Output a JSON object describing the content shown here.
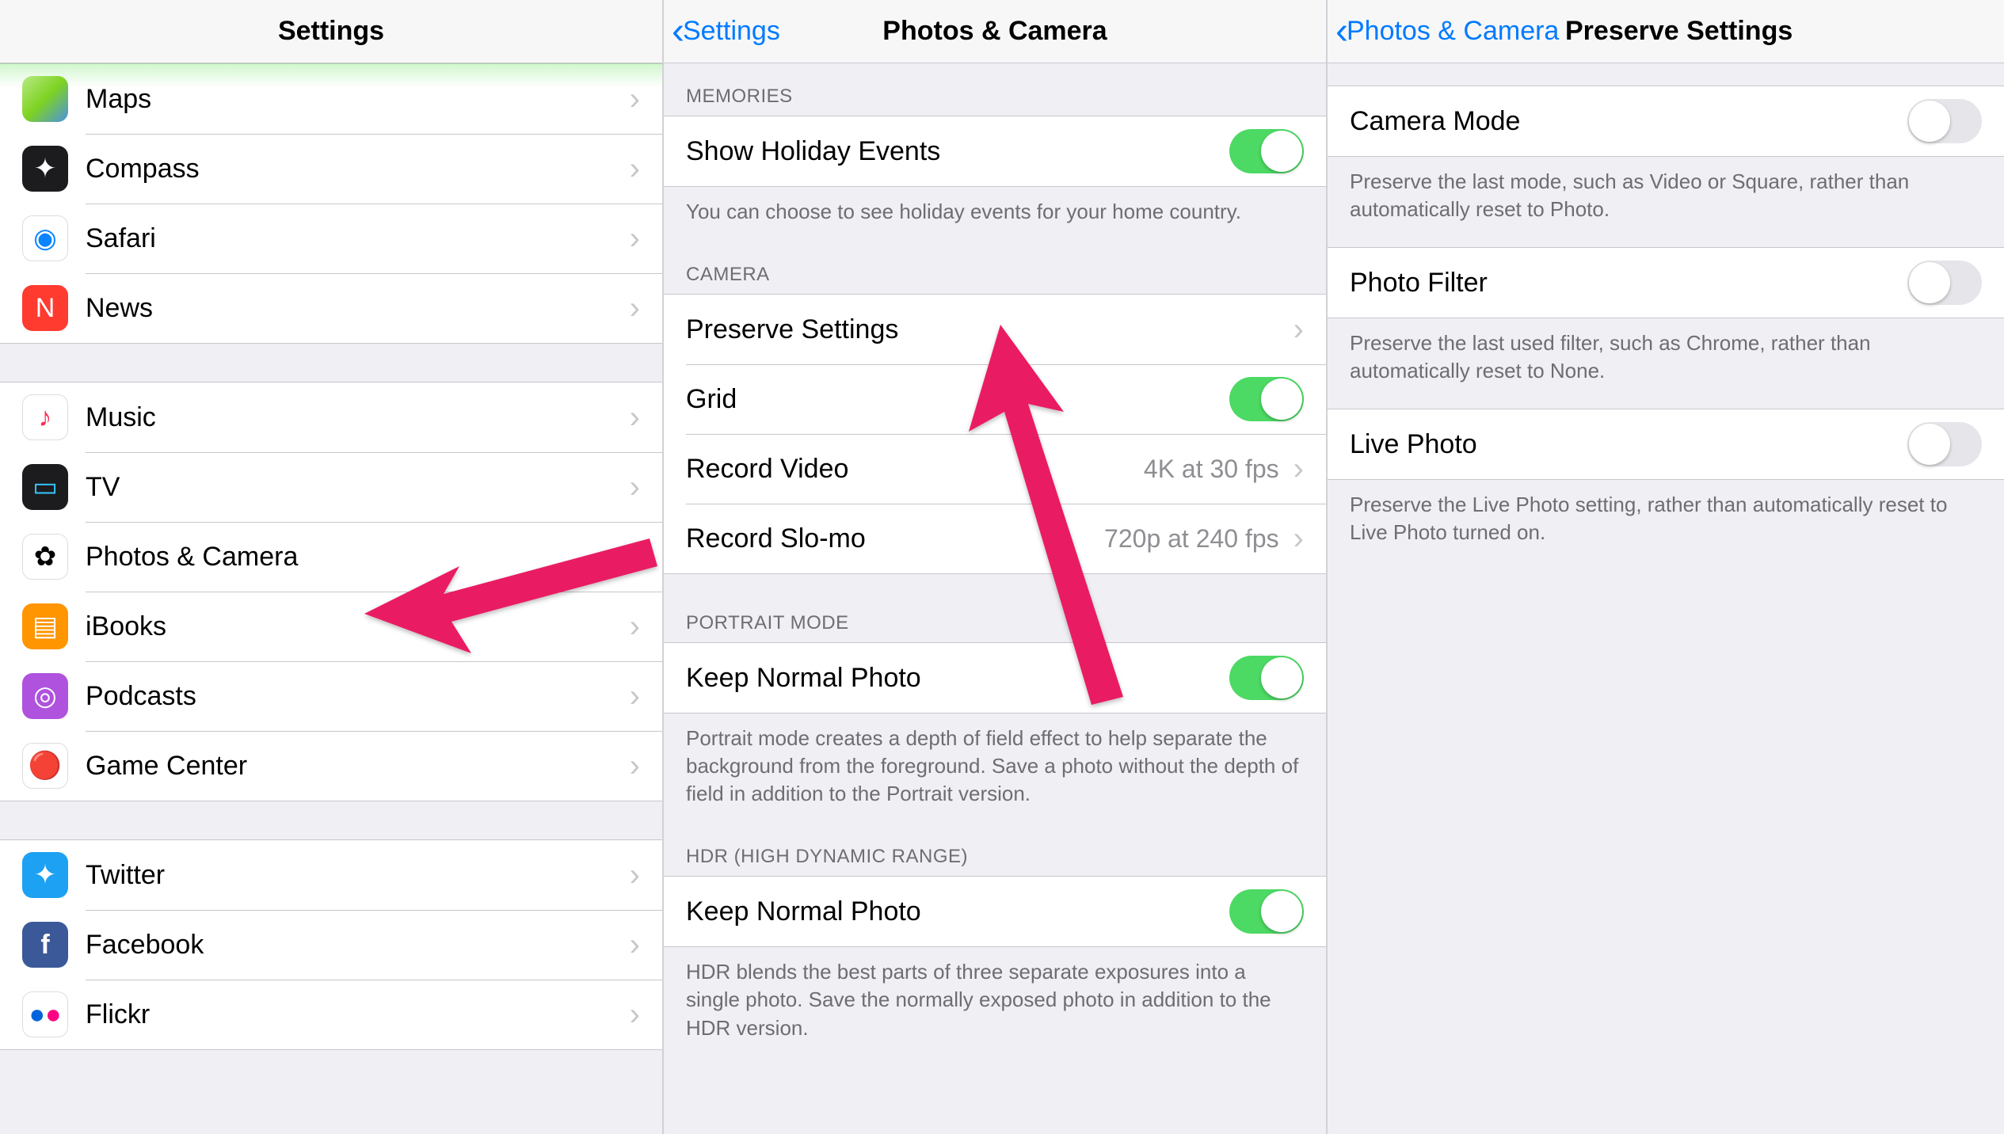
{
  "panel1": {
    "title": "Settings",
    "group1": [
      {
        "icon": "maps",
        "label": "Maps"
      },
      {
        "icon": "compass",
        "label": "Compass"
      },
      {
        "icon": "safari",
        "label": "Safari"
      },
      {
        "icon": "news",
        "label": "News"
      }
    ],
    "group2": [
      {
        "icon": "music",
        "label": "Music"
      },
      {
        "icon": "tv",
        "label": "TV"
      },
      {
        "icon": "photos",
        "label": "Photos & Camera"
      },
      {
        "icon": "ibooks",
        "label": "iBooks"
      },
      {
        "icon": "podcasts",
        "label": "Podcasts"
      },
      {
        "icon": "gamecenter",
        "label": "Game Center"
      }
    ],
    "group3": [
      {
        "icon": "twitter",
        "label": "Twitter"
      },
      {
        "icon": "facebook",
        "label": "Facebook"
      },
      {
        "icon": "flickr",
        "label": "Flickr"
      }
    ]
  },
  "panel2": {
    "back": "Settings",
    "title": "Photos & Camera",
    "memories_header": "MEMORIES",
    "show_holiday": "Show Holiday Events",
    "memories_footer": "You can choose to see holiday events for your home country.",
    "camera_header": "CAMERA",
    "preserve": "Preserve Settings",
    "grid": "Grid",
    "record_video": "Record Video",
    "record_video_val": "4K at 30 fps",
    "record_slomo": "Record Slo-mo",
    "record_slomo_val": "720p at 240 fps",
    "portrait_header": "PORTRAIT MODE",
    "keep_normal": "Keep Normal Photo",
    "portrait_footer": "Portrait mode creates a depth of field effect to help separate the background from the foreground. Save a photo without the depth of field in addition to the Portrait version.",
    "hdr_header": "HDR (HIGH DYNAMIC RANGE)",
    "hdr_keep": "Keep Normal Photo",
    "hdr_footer": "HDR blends the best parts of three separate exposures into a single photo. Save the normally exposed photo in addition to the HDR version."
  },
  "panel3": {
    "back": "Photos & Camera",
    "title": "Preserve Settings",
    "camera_mode": "Camera Mode",
    "camera_mode_footer": "Preserve the last mode, such as Video or Square, rather than automatically reset to Photo.",
    "photo_filter": "Photo Filter",
    "photo_filter_footer": "Preserve the last used filter, such as Chrome, rather than automatically reset to None.",
    "live_photo": "Live Photo",
    "live_photo_footer": "Preserve the Live Photo setting, rather than automatically reset to Live Photo turned on."
  },
  "icons": {
    "maps": "🗺️",
    "compass": "🧭",
    "safari": "🧭",
    "news": "📰",
    "music": "♪",
    "tv": "📺",
    "photos": "🌸",
    "ibooks": "📖",
    "podcasts": "◎",
    "gamecenter": "🎮",
    "twitter": "🐦",
    "facebook": "f",
    "flickr": "••"
  }
}
